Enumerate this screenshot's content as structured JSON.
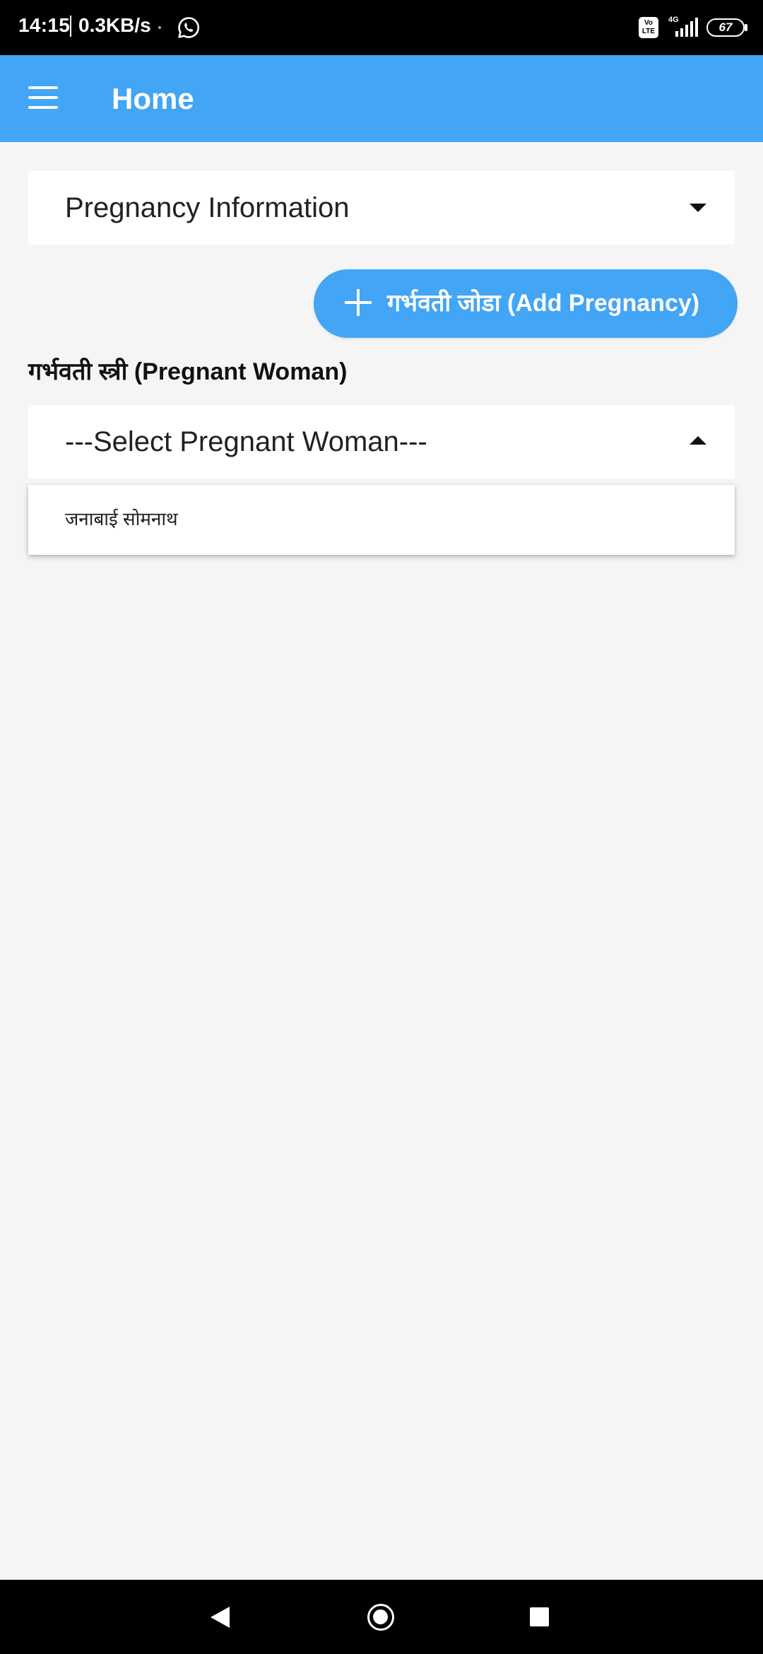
{
  "status_bar": {
    "time": "14:15",
    "network_speed": "0.3KB/s",
    "volte_label": "Vo LTE",
    "network_type": "4G",
    "battery_level": "67",
    "icons": [
      "whatsapp-icon",
      "volte-icon",
      "signal-icon",
      "battery-icon"
    ]
  },
  "app_bar": {
    "title": "Home",
    "menu_icon": "hamburger-menu-icon",
    "color": "#42a5f5"
  },
  "pregnancy_info_dropdown": {
    "label": "Pregnancy Information",
    "icon": "caret-down-icon"
  },
  "add_pregnancy_button": {
    "label": "गर्भवती जोडा (Add Pregnancy)",
    "icon": "plus-icon",
    "color": "#42a5f5"
  },
  "pregnant_woman_section": {
    "label": "गर्भवती स्त्री (Pregnant Woman)"
  },
  "pregnant_woman_select": {
    "selected_value": "---Select Pregnant Woman---",
    "icon": "caret-up-icon",
    "expanded": true,
    "options": [
      "जनाबाई सोमनाथ"
    ]
  },
  "nav_bar": {
    "icons": [
      "back-icon",
      "home-icon",
      "recents-icon"
    ]
  }
}
